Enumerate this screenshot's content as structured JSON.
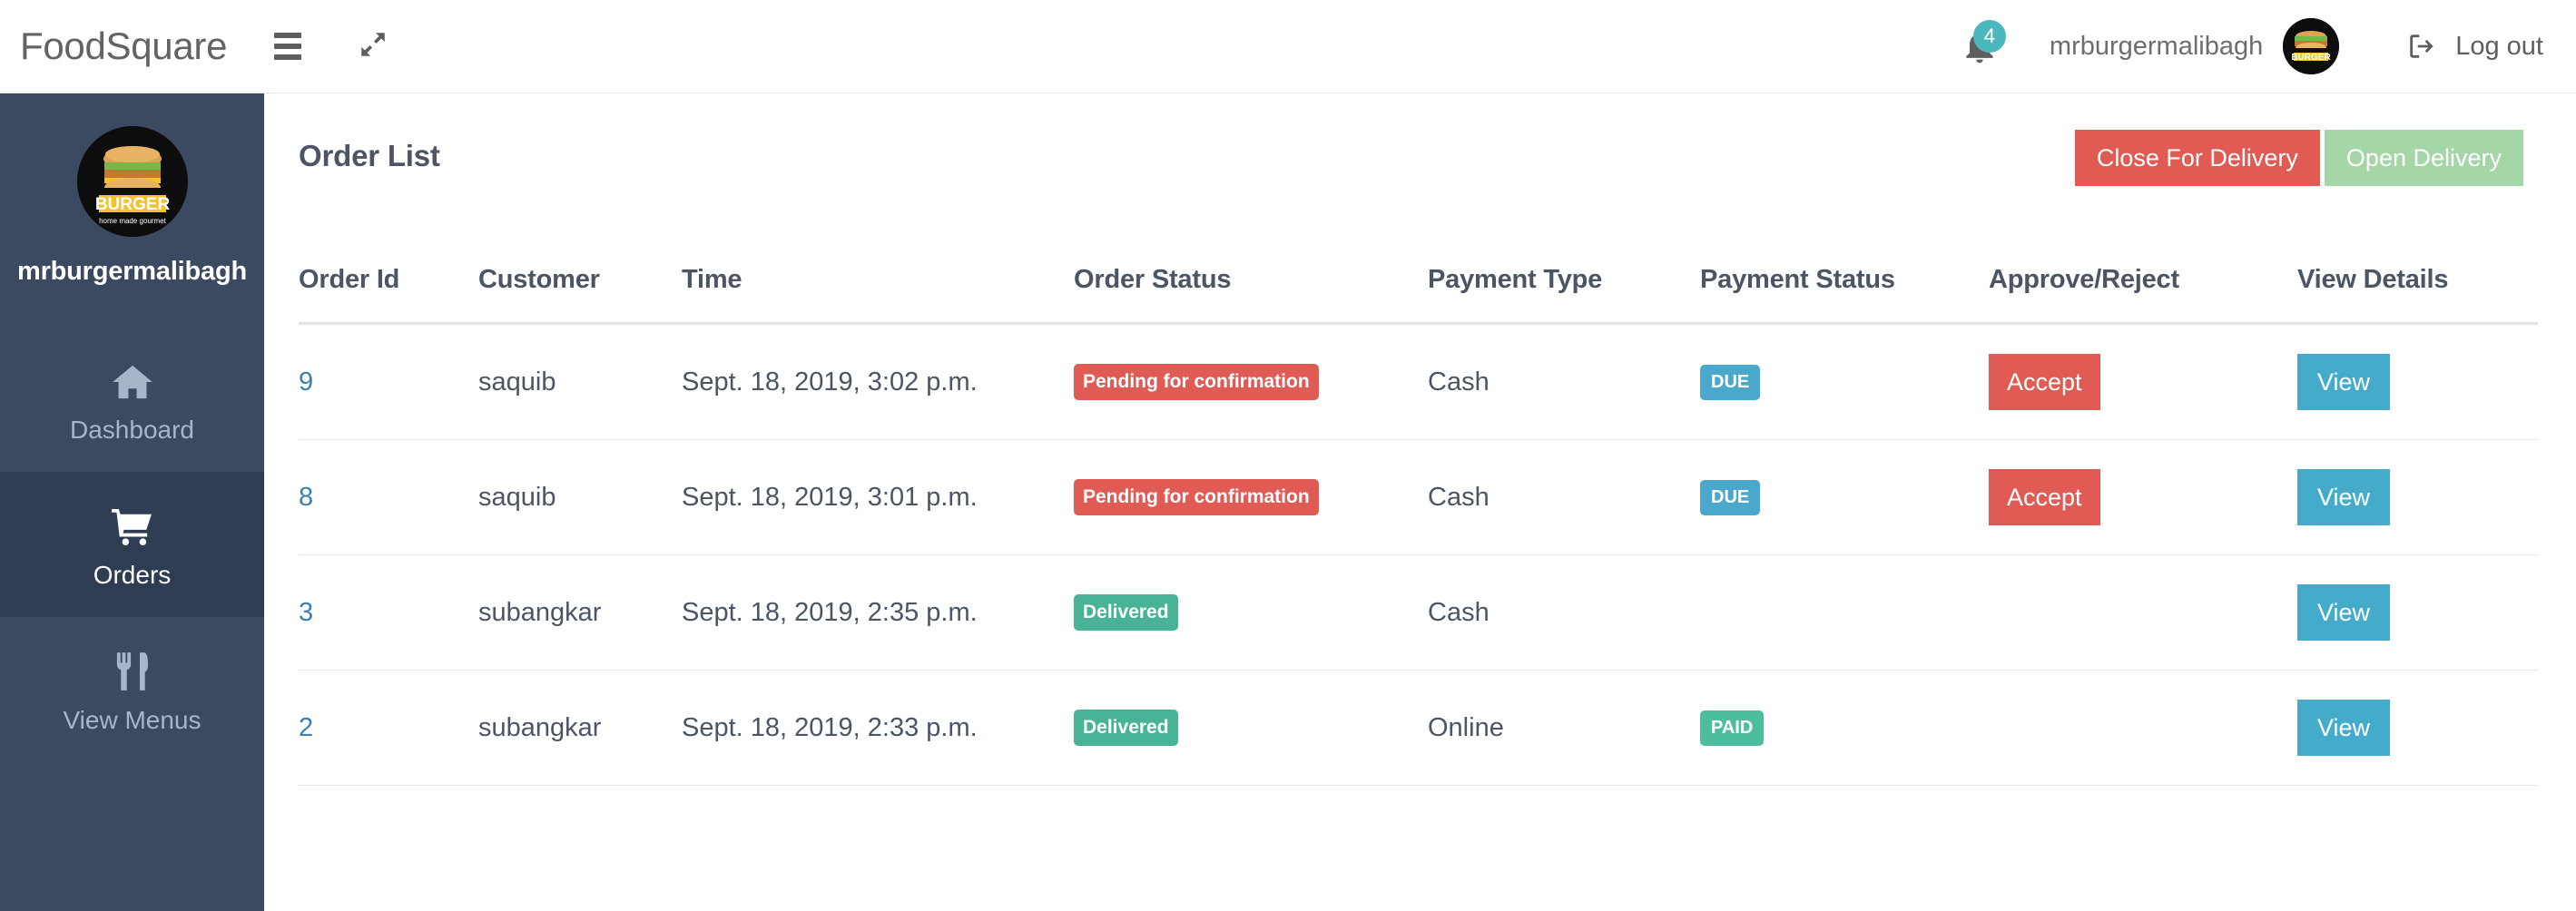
{
  "header": {
    "brand": "FoodSquare",
    "menu_icon": "hamburger-icon",
    "expand_icon": "expand-arrows-icon",
    "notification_count": "4",
    "username": "mrburgermalibagh",
    "logout_label": "Log out",
    "logout_icon": "sign-out-icon",
    "avatar_alt": "Mr. Burger home made gourmet"
  },
  "sidebar": {
    "username": "mrburgermalibagh",
    "avatar_alt": "Mr. Burger home made gourmet",
    "items": [
      {
        "label": "Dashboard",
        "icon": "home-icon",
        "active": false
      },
      {
        "label": "Orders",
        "icon": "cart-icon",
        "active": true
      },
      {
        "label": "View Menus",
        "icon": "cutlery-icon",
        "active": false
      }
    ]
  },
  "main": {
    "title": "Order List",
    "actions": {
      "close_delivery": "Close For Delivery",
      "open_delivery": "Open Delivery"
    },
    "table": {
      "columns": [
        "Order Id",
        "Customer",
        "Time",
        "Order Status",
        "Payment Type",
        "Payment Status",
        "Approve/Reject",
        "View Details"
      ],
      "rows": [
        {
          "order_id": "9",
          "customer": "saquib",
          "time": "Sept. 18, 2019, 3:02 p.m.",
          "order_status": "Pending for confirmation",
          "order_status_type": "pending",
          "payment_type": "Cash",
          "payment_status": "DUE",
          "payment_status_type": "due",
          "approve_label": "Accept",
          "view_label": "View"
        },
        {
          "order_id": "8",
          "customer": "saquib",
          "time": "Sept. 18, 2019, 3:01 p.m.",
          "order_status": "Pending for confirmation",
          "order_status_type": "pending",
          "payment_type": "Cash",
          "payment_status": "DUE",
          "payment_status_type": "due",
          "approve_label": "Accept",
          "view_label": "View"
        },
        {
          "order_id": "3",
          "customer": "subangkar",
          "time": "Sept. 18, 2019, 2:35 p.m.",
          "order_status": "Delivered",
          "order_status_type": "delivered",
          "payment_type": "Cash",
          "payment_status": "",
          "payment_status_type": "",
          "approve_label": "",
          "view_label": "View"
        },
        {
          "order_id": "2",
          "customer": "subangkar",
          "time": "Sept. 18, 2019, 2:33 p.m.",
          "order_status": "Delivered",
          "order_status_type": "delivered",
          "payment_type": "Online",
          "payment_status": "PAID",
          "payment_status_type": "paid",
          "approve_label": "",
          "view_label": "View"
        }
      ]
    }
  },
  "colors": {
    "sidebar_bg": "#3b4a61",
    "sidebar_active_bg": "#2f3d52",
    "danger": "#e15b55",
    "success_light": "#a5d6a7",
    "success": "#48b396",
    "info": "#45abcb",
    "badge_due": "#4aa8cd",
    "badge_paid": "#4dbd9e",
    "accent_teal": "#4bb8bd",
    "link": "#3c7fb1",
    "text": "#4b5563"
  }
}
